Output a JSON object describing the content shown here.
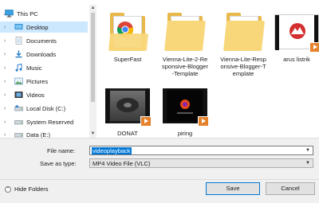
{
  "nav": {
    "items": [
      {
        "label": "This PC",
        "icon": "monitor-icon",
        "top": true
      },
      {
        "label": "Desktop",
        "icon": "desktop-icon",
        "selected": true
      },
      {
        "label": "Documents",
        "icon": "documents-icon"
      },
      {
        "label": "Downloads",
        "icon": "downloads-icon"
      },
      {
        "label": "Music",
        "icon": "music-icon"
      },
      {
        "label": "Pictures",
        "icon": "pictures-icon"
      },
      {
        "label": "Videos",
        "icon": "videos-icon"
      },
      {
        "label": "Local Disk (C:)",
        "icon": "drive-icon"
      },
      {
        "label": "System Reserved",
        "icon": "drive-icon"
      },
      {
        "label": "Data (E:)",
        "icon": "drive-icon"
      }
    ]
  },
  "files": [
    {
      "name": "SuperFast",
      "kind": "chrome-folder"
    },
    {
      "name": "Vienna-Lite-2-Responsive-Blogger-Template",
      "kind": "folder"
    },
    {
      "name": "Vienna-Lite-Responsive-Blogger-Template",
      "kind": "folder"
    },
    {
      "name": "arus listrik",
      "kind": "video-red"
    },
    {
      "name": "DONAT",
      "kind": "video-gray"
    },
    {
      "name": "piring",
      "kind": "video-dark"
    }
  ],
  "form": {
    "file_name_label": "File name:",
    "file_name_value": "videoplayback",
    "save_type_label": "Save as type:",
    "save_type_value": "MP4 Video File (VLC)"
  },
  "buttons": {
    "save": "Save",
    "cancel": "Cancel",
    "hide_folders": "Hide Folders"
  },
  "colors": {
    "selection": "#cce8ff",
    "accent": "#0078d7",
    "folder": "#f8d77a",
    "play_badge": "#e7822c"
  }
}
